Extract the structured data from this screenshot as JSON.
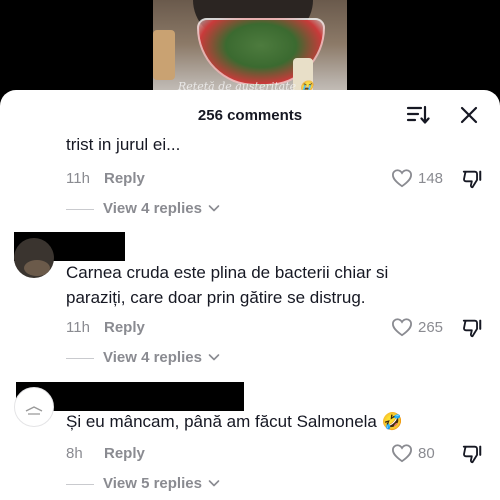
{
  "video": {
    "caption": "Rețetă de austeritate 😭"
  },
  "sheet": {
    "comments_count": "256 comments"
  },
  "comments": [
    {
      "text_lines": [
        "trist in jurul ei..."
      ],
      "time": "11h",
      "reply_label": "Reply",
      "likes": "148",
      "replies": "View 4 replies"
    },
    {
      "text_lines": [
        "Carnea cruda este plina de bacterii chiar si",
        "paraziți, care doar prin gătire se distrug."
      ],
      "time": "11h",
      "reply_label": "Reply",
      "likes": "265",
      "replies": "View 4 replies"
    },
    {
      "text_lines": [
        "Și eu mâncam, până am făcut Salmonela 🤣"
      ],
      "time": "8h",
      "reply_label": "Reply",
      "likes": "80",
      "replies": "View 5 replies"
    }
  ],
  "colors": {
    "text_primary": "#161823",
    "text_secondary": "#8a8b91",
    "background": "#ffffff",
    "redaction": "#000000"
  },
  "icons": [
    "sort-icon",
    "close-icon",
    "heart-outline-icon",
    "dislike-icon",
    "chevron-down-icon"
  ]
}
